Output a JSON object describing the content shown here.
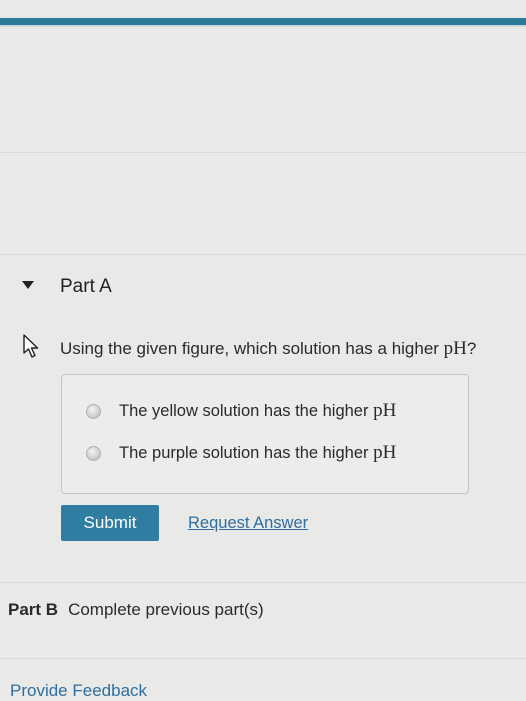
{
  "part_a": {
    "title": "Part A",
    "question_prefix": "Using the given figure, which solution has a higher ",
    "question_ph": "pH",
    "question_suffix": "?",
    "choices": [
      {
        "text": "The yellow solution has the higher ",
        "ph": "pH"
      },
      {
        "text": "The purple solution has the higher ",
        "ph": "pH"
      }
    ],
    "submit_label": "Submit",
    "request_answer_label": "Request Answer"
  },
  "part_b": {
    "label": "Part B",
    "status": "Complete previous part(s)"
  },
  "footer": {
    "feedback_label": "Provide Feedback"
  },
  "colors": {
    "accent_bar": "#2a7a9c",
    "submit_bg": "#2f7ea2",
    "link": "#2f6ea0"
  }
}
